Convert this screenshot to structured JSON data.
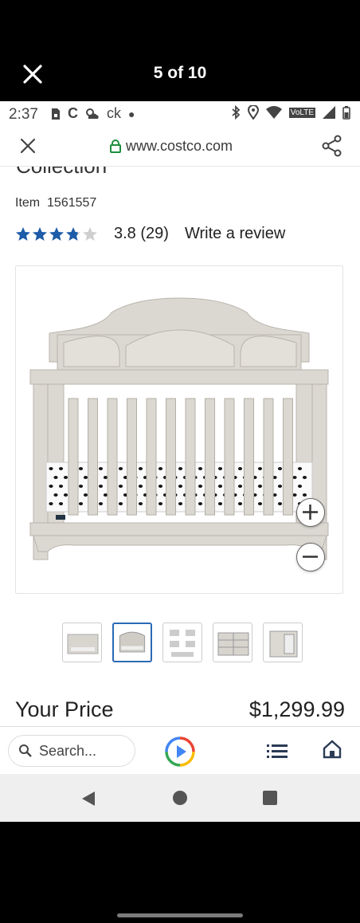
{
  "viewer": {
    "counter": "5 of 10"
  },
  "status_bar": {
    "time": "2:37",
    "carrier_text": "ck",
    "volte": "VoLTE"
  },
  "browser": {
    "url": "www.costco.com"
  },
  "product": {
    "title_partial": "Collection",
    "item_label": "Item",
    "item_number": "1561557",
    "rating_value": "3.8",
    "rating_count": "(29)",
    "rating_stars": 3.8,
    "write_review": "Write a review",
    "price_label": "Your Price",
    "price": "$1,299.99",
    "thumbnails": [
      "crib-room",
      "crib-front",
      "crib-parts",
      "dresser",
      "dresser-open"
    ],
    "active_thumbnail": 1
  },
  "bottom_bar": {
    "search_placeholder": "Search..."
  },
  "colors": {
    "star": "#1d5ca8",
    "thumb_active": "#2a6ab4",
    "crib": "#d9d6d0"
  }
}
